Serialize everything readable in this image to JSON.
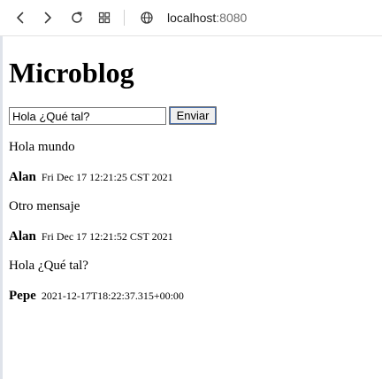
{
  "browser": {
    "url_host": "localhost",
    "url_port": ":8080",
    "icons": [
      "back-icon",
      "forward-icon",
      "reload-icon",
      "tabs-grid-icon",
      "site-info-icon"
    ]
  },
  "page": {
    "title": "Microblog",
    "input_value": "Hola ¿Qué tal?",
    "send_label": "Enviar",
    "messages": [
      {
        "text": "Hola mundo",
        "author": "Alan",
        "date": "Fri Dec 17 12:21:25 CST 2021"
      },
      {
        "text": "Otro mensaje",
        "author": "Alan",
        "date": "Fri Dec 17 12:21:52 CST 2021"
      },
      {
        "text": "Hola ¿Qué tal?",
        "author": "Pepe",
        "date": "2021-12-17T18:22:37.315+00:00"
      }
    ]
  }
}
